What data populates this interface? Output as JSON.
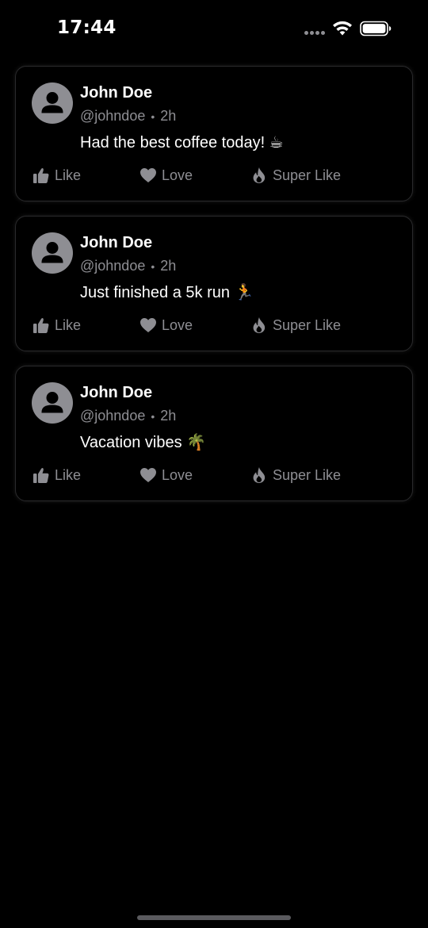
{
  "status_bar": {
    "time": "17:44"
  },
  "posts": [
    {
      "author": "John Doe",
      "handle": "@johndoe",
      "separator": "•",
      "age": "2h",
      "text": "Had the best coffee today! ☕",
      "actions": {
        "like": "Like",
        "love": "Love",
        "super_like": "Super Like"
      }
    },
    {
      "author": "John Doe",
      "handle": "@johndoe",
      "separator": "•",
      "age": "2h",
      "text": "Just finished a 5k run 🏃",
      "actions": {
        "like": "Like",
        "love": "Love",
        "super_like": "Super Like"
      }
    },
    {
      "author": "John Doe",
      "handle": "@johndoe",
      "separator": "•",
      "age": "2h",
      "text": "Vacation vibes 🌴",
      "actions": {
        "like": "Like",
        "love": "Love",
        "super_like": "Super Like"
      }
    }
  ],
  "theme": {
    "background": "#000000",
    "primary_text": "#ffffff",
    "secondary_text": "#8e8e93",
    "card_border": "#2a2a2c"
  },
  "icons": {
    "like": "thumbs-up-icon",
    "love": "heart-icon",
    "super_like": "flame-icon",
    "avatar": "person-icon"
  }
}
